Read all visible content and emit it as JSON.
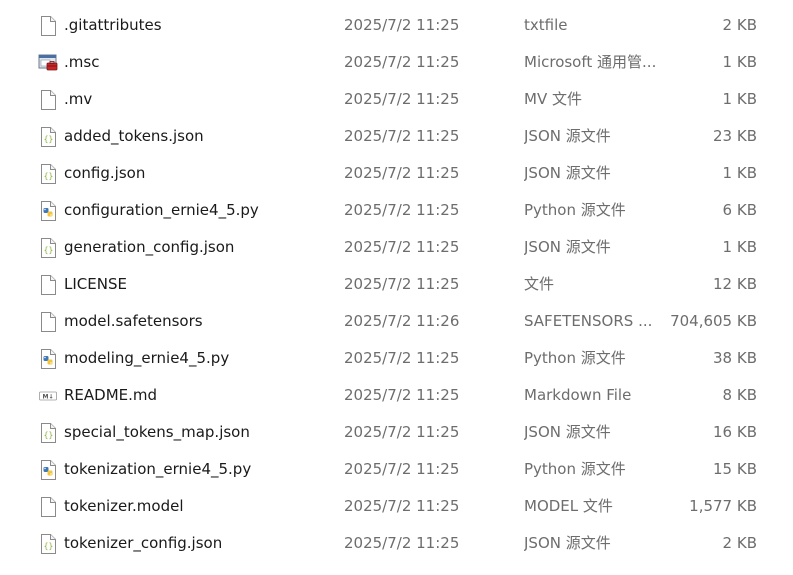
{
  "files": [
    {
      "name": ".gitattributes",
      "modified": "2025/7/2 11:25",
      "type": "txtfile",
      "size": "2 KB",
      "icon": "blank-file-icon"
    },
    {
      "name": ".msc",
      "modified": "2025/7/2 11:25",
      "type": "Microsoft 通用管...",
      "size": "1 KB",
      "icon": "msc-console-icon"
    },
    {
      "name": ".mv",
      "modified": "2025/7/2 11:25",
      "type": "MV 文件",
      "size": "1 KB",
      "icon": "blank-file-icon"
    },
    {
      "name": "added_tokens.json",
      "modified": "2025/7/2 11:25",
      "type": "JSON 源文件",
      "size": "23 KB",
      "icon": "json-file-icon"
    },
    {
      "name": "config.json",
      "modified": "2025/7/2 11:25",
      "type": "JSON 源文件",
      "size": "1 KB",
      "icon": "json-file-icon"
    },
    {
      "name": "configuration_ernie4_5.py",
      "modified": "2025/7/2 11:25",
      "type": "Python 源文件",
      "size": "6 KB",
      "icon": "python-file-icon"
    },
    {
      "name": "generation_config.json",
      "modified": "2025/7/2 11:25",
      "type": "JSON 源文件",
      "size": "1 KB",
      "icon": "json-file-icon"
    },
    {
      "name": "LICENSE",
      "modified": "2025/7/2 11:25",
      "type": "文件",
      "size": "12 KB",
      "icon": "blank-file-icon"
    },
    {
      "name": "model.safetensors",
      "modified": "2025/7/2 11:26",
      "type": "SAFETENSORS ...",
      "size": "704,605 KB",
      "icon": "blank-file-icon"
    },
    {
      "name": "modeling_ernie4_5.py",
      "modified": "2025/7/2 11:25",
      "type": "Python 源文件",
      "size": "38 KB",
      "icon": "python-file-icon"
    },
    {
      "name": "README.md",
      "modified": "2025/7/2 11:25",
      "type": "Markdown File",
      "size": "8 KB",
      "icon": "markdown-file-icon"
    },
    {
      "name": "special_tokens_map.json",
      "modified": "2025/7/2 11:25",
      "type": "JSON 源文件",
      "size": "16 KB",
      "icon": "json-file-icon"
    },
    {
      "name": "tokenization_ernie4_5.py",
      "modified": "2025/7/2 11:25",
      "type": "Python 源文件",
      "size": "15 KB",
      "icon": "python-file-icon"
    },
    {
      "name": "tokenizer.model",
      "modified": "2025/7/2 11:25",
      "type": "MODEL 文件",
      "size": "1,577 KB",
      "icon": "blank-file-icon"
    },
    {
      "name": "tokenizer_config.json",
      "modified": "2025/7/2 11:25",
      "type": "JSON 源文件",
      "size": "2 KB",
      "icon": "json-file-icon"
    }
  ],
  "colors": {
    "name_text": "#1a1a1a",
    "detail_text": "#6d6d6d",
    "json_accent": "#8bb33a",
    "python_blue": "#3d77b6",
    "python_yellow": "#f2c53d",
    "msc_red": "#c62828"
  }
}
